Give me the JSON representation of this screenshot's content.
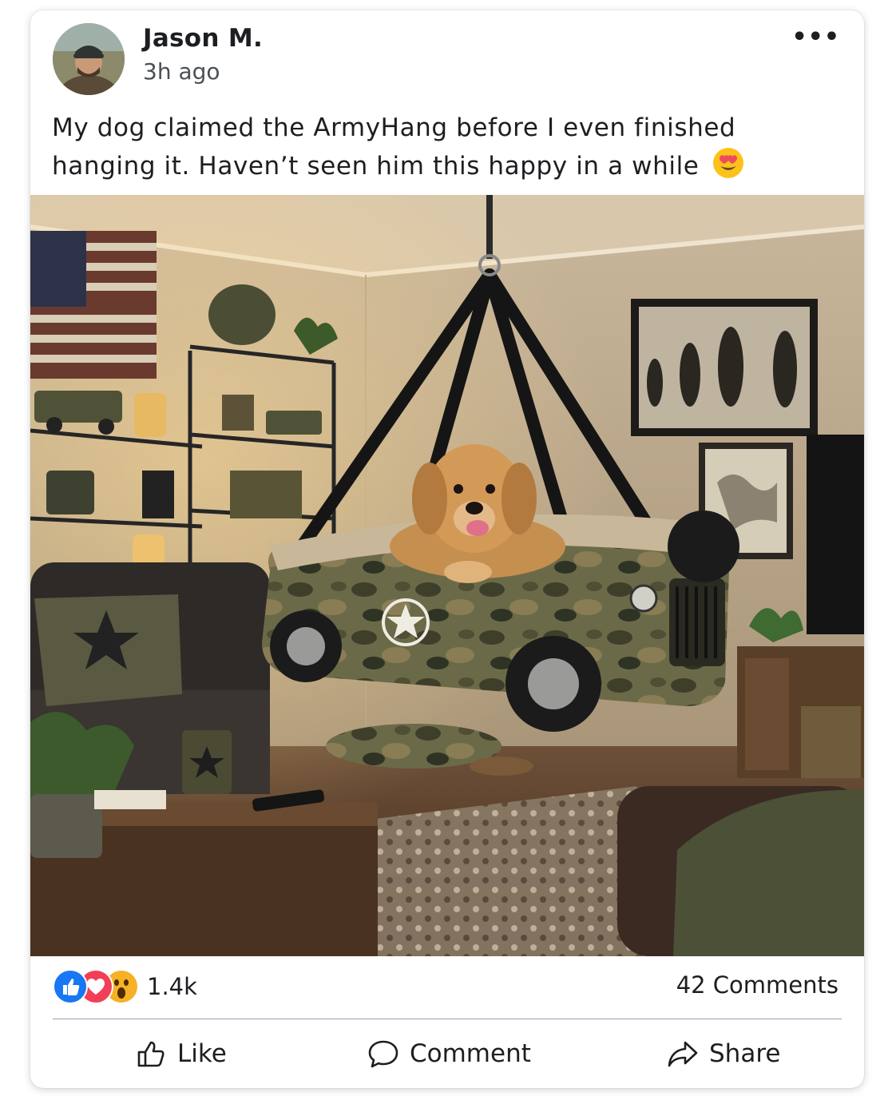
{
  "post": {
    "author": "Jason M.",
    "time": "3h ago",
    "text": "My dog claimed the ArmyHang before I even finished hanging it. Haven’t seen him this happy in a while",
    "text_emoji": "smiling-face-with-heart-eyes"
  },
  "stats": {
    "reaction_count": "1.4k",
    "reactions": [
      "like",
      "love",
      "wow"
    ],
    "comments": "42 Comments"
  },
  "actions": {
    "like": "Like",
    "comment": "Comment",
    "share": "Share"
  },
  "colors": {
    "like_blue": "#1877f2",
    "love_red": "#f33e58",
    "wow_yellow": "#f7b125"
  }
}
